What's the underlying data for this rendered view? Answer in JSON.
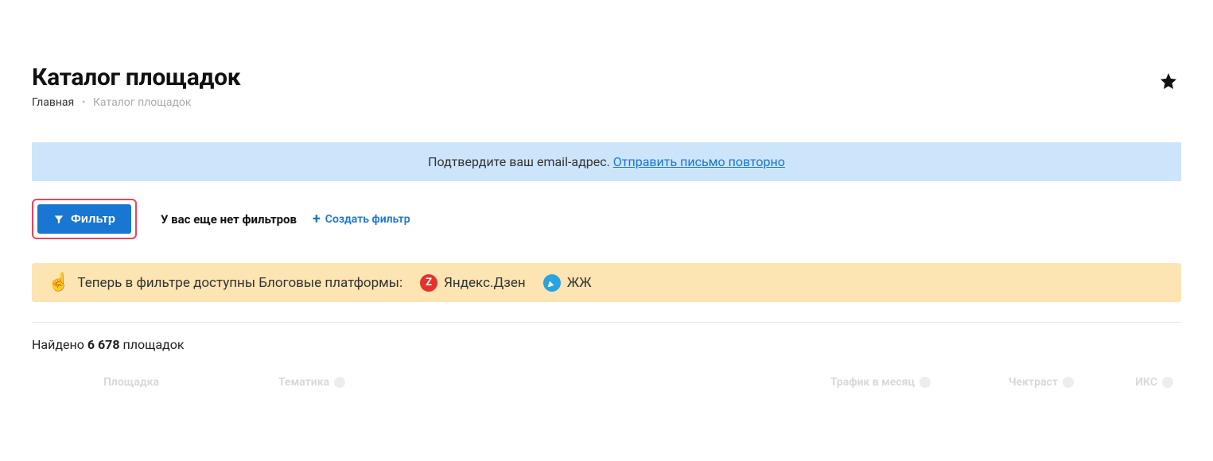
{
  "header": {
    "title": "Каталог площадок"
  },
  "breadcrumb": {
    "home": "Главная",
    "current": "Каталог площадок"
  },
  "notice": {
    "text": "Подтвердите ваш email-адрес.",
    "link_text": "Отправить письмо повторно"
  },
  "filter": {
    "button_label": "Фильтр",
    "no_filters_text": "У вас еще нет фильтров",
    "create_label": "Создать фильтр"
  },
  "banner": {
    "emoji": "☝️",
    "text": "Теперь в фильтре доступны Блоговые платформы:",
    "platform1_label": "Яндекс.Дзен",
    "platform1_badge": "Z",
    "platform2_label": "ЖЖ"
  },
  "results": {
    "prefix": "Найдено",
    "count": "6 678",
    "suffix": "площадок"
  },
  "columns": {
    "site": "Площадка",
    "topic": "Тематика",
    "traffic": "Трафик в месяц",
    "trust": "Чектраст",
    "iks": "ИКС"
  }
}
